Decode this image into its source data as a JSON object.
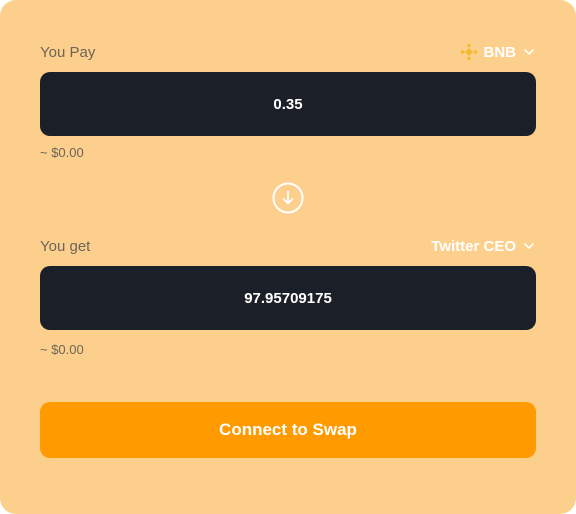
{
  "pay": {
    "label": "You Pay",
    "token": "BNB",
    "amount": "0.35",
    "usd_value": "~ $0.00"
  },
  "get": {
    "label": "You get",
    "token": "Twitter CEO",
    "amount": "97.95709175",
    "usd_value": "~ $0.00"
  },
  "action": {
    "label": "Connect to Swap"
  },
  "colors": {
    "card_bg": "#FDCF8C",
    "input_bg": "#1b1f27",
    "accent": "#FF9A00",
    "bnb_yellow": "#F3BA2F"
  },
  "icons": {
    "pay_token": "bnb-icon",
    "token_dropdown": "chevron-down-icon",
    "swap_direction": "arrow-down-circle-icon"
  }
}
